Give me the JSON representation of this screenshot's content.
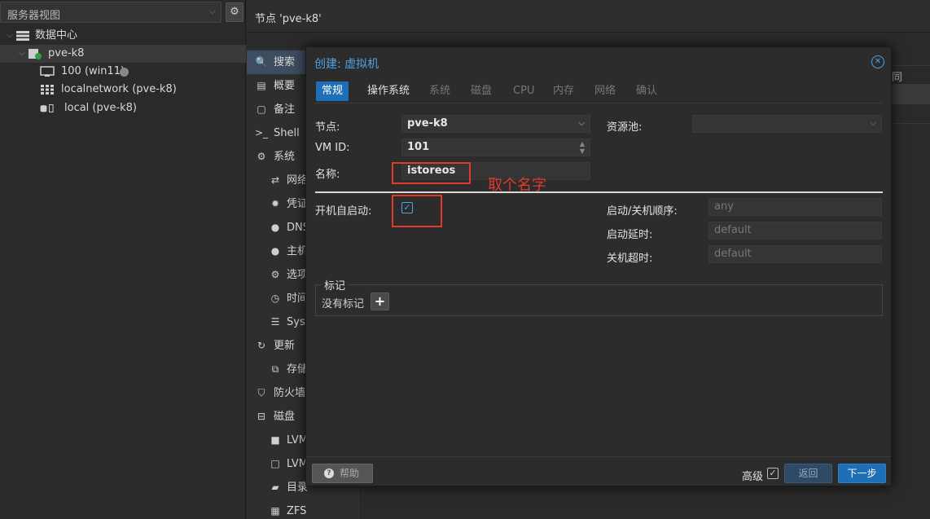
{
  "tree": {
    "view_selector": "服务器视图",
    "datacenter": "数据中心",
    "node": "pve-k8",
    "vm": "100 (win11)",
    "storage1": "localnetwork (pve-k8)",
    "storage2": "local (pve-k8)"
  },
  "node_header": "节点 'pve-k8'",
  "node_menu": {
    "items": [
      {
        "icon": "search-icon",
        "glyph": "🔍",
        "label": "搜索"
      },
      {
        "icon": "book-icon",
        "glyph": "▤",
        "label": "概要"
      },
      {
        "icon": "note-icon",
        "glyph": "▢",
        "label": "备注"
      },
      {
        "icon": "terminal-icon",
        "glyph": ">_",
        "label": "Shell"
      },
      {
        "icon": "cogs-icon",
        "glyph": "⚙",
        "label": "系统"
      },
      {
        "icon": "exchange-icon",
        "glyph": "⇄",
        "label": "网络"
      },
      {
        "icon": "cert-icon",
        "glyph": "✹",
        "label": "凭证"
      },
      {
        "icon": "globe-icon",
        "glyph": "●",
        "label": "DNS"
      },
      {
        "icon": "globe2-icon",
        "glyph": "●",
        "label": "主机"
      },
      {
        "icon": "gear-icon",
        "glyph": "⚙",
        "label": "选项"
      },
      {
        "icon": "clock-icon",
        "glyph": "◷",
        "label": "时间"
      },
      {
        "icon": "list-icon",
        "glyph": "☰",
        "label": "Syslog"
      },
      {
        "icon": "refresh-icon",
        "glyph": "↻",
        "label": "更新"
      },
      {
        "icon": "copy-icon",
        "glyph": "⧉",
        "label": "存储"
      },
      {
        "icon": "shield-icon",
        "glyph": "⛉",
        "label": "防火墙"
      },
      {
        "icon": "drive-icon",
        "glyph": "⊟",
        "label": "磁盘"
      },
      {
        "icon": "square-icon",
        "glyph": "■",
        "label": "LVM"
      },
      {
        "icon": "square-o-icon",
        "glyph": "□",
        "label": "LVM-Thin"
      },
      {
        "icon": "folder-icon",
        "glyph": "▰",
        "label": "目录"
      },
      {
        "icon": "th-icon",
        "glyph": "▦",
        "label": "ZFS"
      }
    ]
  },
  "bg_fragment": "同",
  "dialog": {
    "title": "创建: 虚拟机",
    "tabs": [
      "常规",
      "操作系统",
      "系统",
      "磁盘",
      "CPU",
      "内存",
      "网络",
      "确认"
    ],
    "node_label": "节点:",
    "node_value": "pve-k8",
    "vmid_label": "VM ID:",
    "vmid_value": "101",
    "name_label": "名称:",
    "name_value": "istoreos",
    "pool_label": "资源池:",
    "autostart_label": "开机自启动:",
    "order_label": "启动/关机顺序:",
    "order_value": "any",
    "delay_label": "启动延时:",
    "delay_value": "default",
    "shutdown_label": "关机超时:",
    "shutdown_value": "default",
    "tags_legend": "标记",
    "tags_none": "没有标记",
    "help": "帮助",
    "advanced": "高级",
    "back": "返回",
    "next": "下一步"
  },
  "annotation": "取个名字",
  "colors": {
    "accent": "#1f6fb6",
    "annotation": "#e03a2e",
    "title": "#4da3e6"
  }
}
